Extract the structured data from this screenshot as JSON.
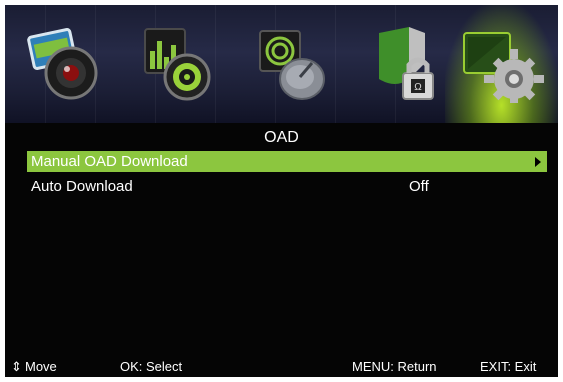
{
  "title": "OAD",
  "menu": {
    "items": [
      {
        "label": "Manual OAD Download",
        "value": "",
        "selected": true
      },
      {
        "label": "Auto Download",
        "value": "Off",
        "selected": false
      }
    ]
  },
  "categories": [
    {
      "icon": "picture-icon"
    },
    {
      "icon": "sound-icon"
    },
    {
      "icon": "channel-icon"
    },
    {
      "icon": "lock-icon"
    },
    {
      "icon": "setup-gear-icon",
      "active": true
    }
  ],
  "footer": {
    "move_glyph": "⇕",
    "move": "Move",
    "ok": "OK: Select",
    "menu": "MENU: Return",
    "exit": "EXIT: Exit"
  },
  "colors": {
    "highlight": "#8cc63f",
    "background": "#050505",
    "active_glow": "#b4e02a"
  }
}
